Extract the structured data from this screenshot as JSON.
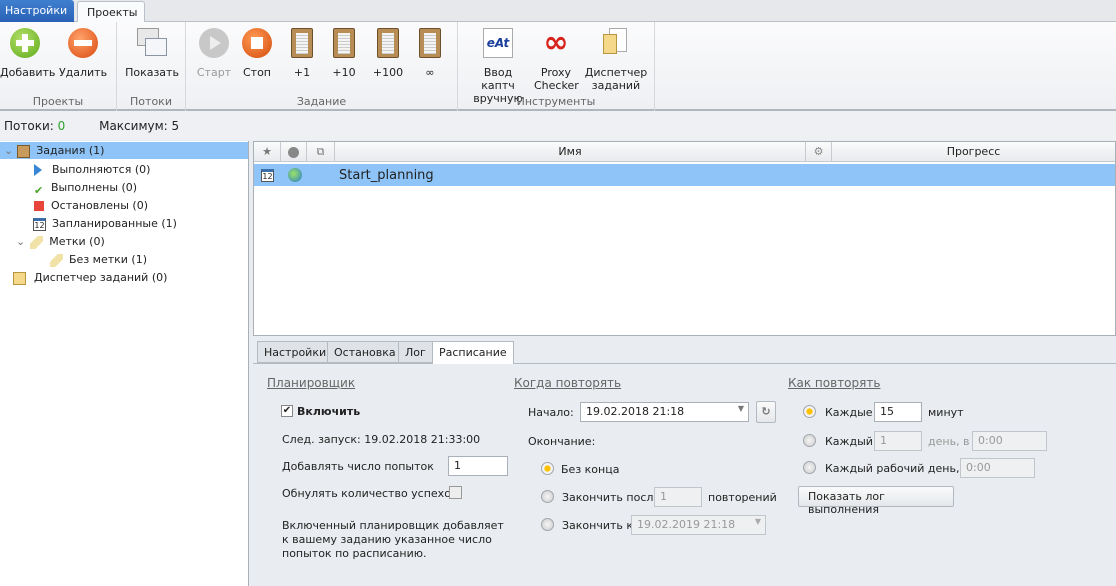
{
  "top_tabs": [
    "Настройки",
    "Проекты"
  ],
  "ribbon": {
    "groups": [
      "Проекты",
      "Потоки",
      "Задание",
      "Инструменты"
    ],
    "buttons": {
      "add": "Добавить",
      "remove": "Удалить",
      "show": "Показать",
      "start": "Старт",
      "stop": "Стоп",
      "plus1": "+1",
      "plus10": "+10",
      "plus100": "+100",
      "infinite": "∞",
      "captcha_l1": "Ввод каптч",
      "captcha_l2": "вручную",
      "proxy_l1": "Proxy",
      "proxy_l2": "Checker",
      "dispatcher_l1": "Диспетчер",
      "dispatcher_l2": "заданий"
    }
  },
  "status": {
    "threads_label": "Потоки:",
    "threads": "0",
    "max_label": "Максимум:",
    "max": "5"
  },
  "tree": [
    "Задания (1)",
    "Выполняются (0)",
    "Выполнены (0)",
    "Остановлены (0)",
    "Запланированные (1)",
    "Метки (0)",
    "Без метки (1)",
    "Диспетчер заданий (0)"
  ],
  "grid": {
    "columns": {
      "name": "Имя",
      "progress": "Прогресс"
    },
    "rows": [
      {
        "name": "Start_planning"
      }
    ]
  },
  "detail_tabs": [
    "Настройки",
    "Остановка",
    "Лог",
    "Расписание"
  ],
  "schedule": {
    "planner_title": "Планировщик",
    "enable": "Включить",
    "next_run": "След. запуск: 19.02.2018 21:33:00",
    "add_attempts_label": "Добавлять число попыток",
    "add_attempts": "1",
    "reset_success_label": "Обнулять количество успехов",
    "note": "Включенный планировщик добавляет к вашему заданию указанное число попыток по расписанию.",
    "when_title": "Когда повторять",
    "start_label": "Начало:",
    "start_value": "19.02.2018 21:18",
    "end_label": "Окончание:",
    "no_end": "Без конца",
    "end_after": "Закончить после",
    "end_after_value": "1",
    "repeats": "повторений",
    "end_by": "Закончить к",
    "end_by_value": "19.02.2019 21:18",
    "how_title": "Как повторять",
    "every": "Каждые",
    "every_value": "15",
    "minutes": "минут",
    "every_day": "Каждый",
    "every_day_value": "1",
    "day_at": "день, в",
    "day_time": "0:00",
    "every_workday": "Каждый рабочий день, в",
    "workday_time": "0:00",
    "show_log": "Показать лог выполнения"
  },
  "colors": {
    "accent": "#2a62b6",
    "selection": "#8ec4f7",
    "threads": "#2ea02e"
  }
}
